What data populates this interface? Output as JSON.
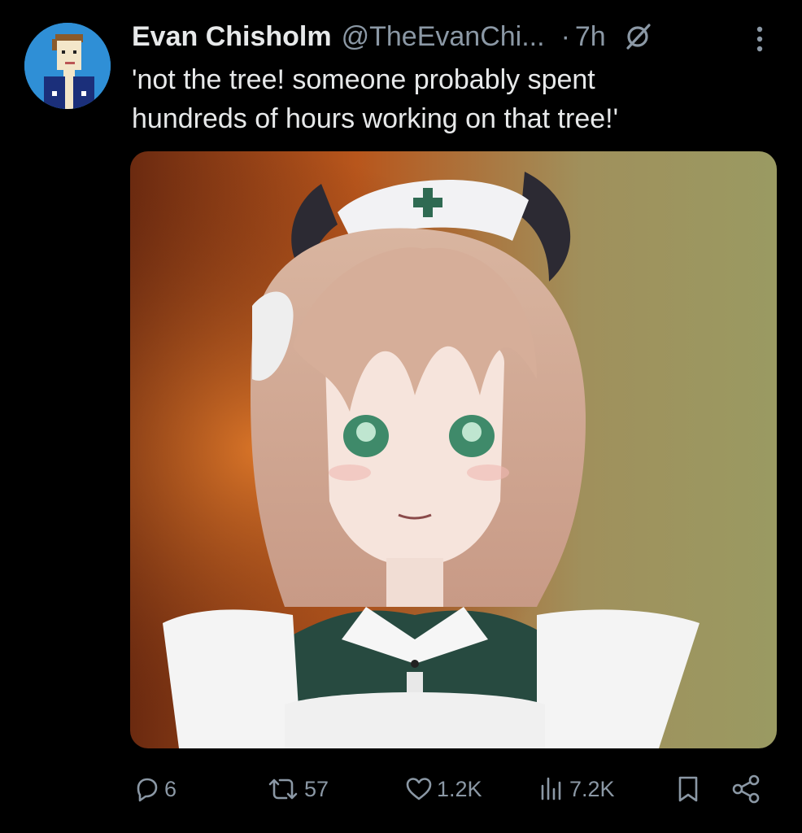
{
  "tweet": {
    "author_name": "Evan Chisholm",
    "author_handle": "@TheEvanChi...",
    "separator": "·",
    "time": "7h",
    "text": "'not the tree! someone probably spent\nhundreds of hours working on that tree!'",
    "avatar_icon": "pixel-art-person-avatar",
    "media_alt": "anime nurse character with horns in front of fiery background"
  },
  "actions": {
    "replies": "6",
    "retweets": "57",
    "likes": "1.2K",
    "views": "7.2K"
  },
  "colors": {
    "background": "#000000",
    "text_primary": "#e7e9ea",
    "text_secondary": "#8b98a5",
    "avatar_bg": "#2f8fd6"
  }
}
